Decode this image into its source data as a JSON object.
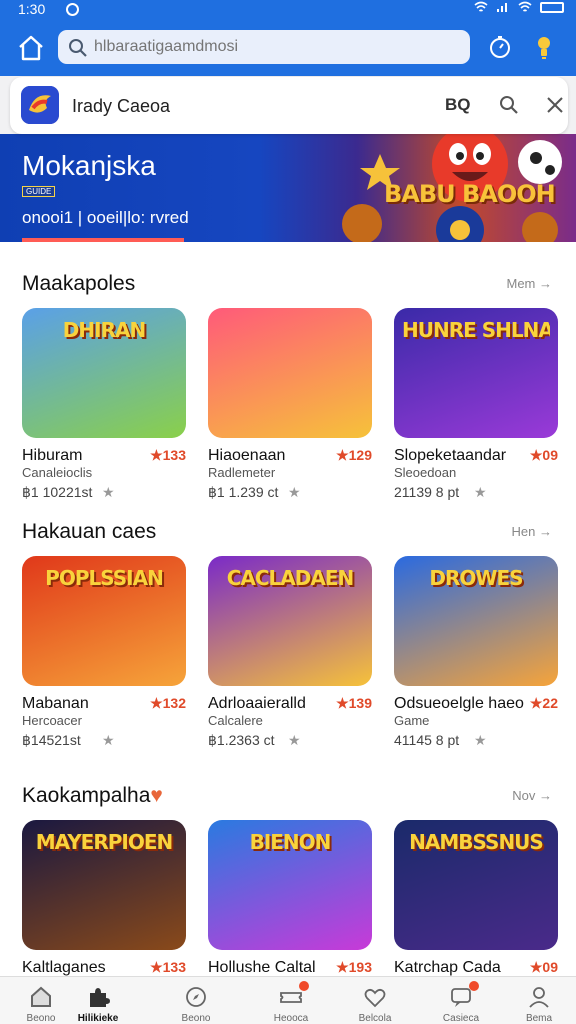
{
  "status": {
    "time": "1:30"
  },
  "search": {
    "placeholder": "hlbaraatigaamdmosi"
  },
  "card": {
    "app_name": "Irady Caeoa",
    "code_label": "BQ"
  },
  "hero": {
    "title": "Mokanjska",
    "tag": "GUIDE",
    "subtitle": "onooi1 | ooeil|lo: rvred",
    "art_text": "BABU BAOOH"
  },
  "sections": [
    {
      "title": "Maakapoles",
      "more": "Mem",
      "games": [
        {
          "name": "Hiburam",
          "sub": "Canaleioclis",
          "downloads": "฿1 10221st",
          "rating": "★133",
          "banner": "DHIRAN",
          "colors": [
            "#5aa0e8",
            "#8ad04a"
          ]
        },
        {
          "name": "Hiaoenaan",
          "sub": "Radlemeter",
          "downloads": "฿1 1.239 ct",
          "rating": "★129",
          "banner": "",
          "colors": [
            "#ff5a7a",
            "#f6c23a"
          ]
        },
        {
          "name": "Slopeketaandar",
          "sub": "Sleoedoan",
          "downloads": "21139 8 pt",
          "rating": "★09",
          "banner": "HUNRE SHLNAN",
          "colors": [
            "#3a2aa8",
            "#9a3ad8"
          ]
        }
      ]
    },
    {
      "title": "Hakauan caes",
      "more": "Hen",
      "games": [
        {
          "name": "Mabanan",
          "sub": "Hercoacer",
          "downloads": "฿14521st",
          "rating": "★132",
          "banner": "POPLSSIAN",
          "colors": [
            "#e0381a",
            "#f6a43a"
          ]
        },
        {
          "name": "Adrloaaieralld",
          "sub": "Calcalere",
          "downloads": "฿1.2363 ct",
          "rating": "★139",
          "banner": "CACLADAEN",
          "colors": [
            "#7a2ac8",
            "#f6c23a"
          ]
        },
        {
          "name": "Odsueoelgle haeo",
          "sub": "Game",
          "downloads": "41145 8 pt",
          "rating": "★22",
          "banner": "DROWES",
          "colors": [
            "#2a6ae0",
            "#f6a43a"
          ]
        }
      ]
    },
    {
      "title": "Kaokampalha",
      "more": "Nov",
      "games": [
        {
          "name": "Kaltlaganes",
          "sub": "",
          "downloads": "",
          "rating": "★133",
          "banner": "MAYERPIOEN",
          "colors": [
            "#1a1840",
            "#8a4a1a"
          ]
        },
        {
          "name": "Hollushe Caltal",
          "sub": "",
          "downloads": "",
          "rating": "★193",
          "banner": "BIENON",
          "colors": [
            "#2a7ae0",
            "#c83ad8"
          ]
        },
        {
          "name": "Katrchap Cada",
          "sub": "",
          "downloads": "",
          "rating": "★09",
          "banner": "NAMBSSNUS",
          "colors": [
            "#1a2a6a",
            "#4a2a8a"
          ]
        }
      ]
    }
  ],
  "tabs": [
    {
      "label": "Beono",
      "icon": "home-icon"
    },
    {
      "label": "Hilikieke",
      "icon": "puzzle-icon"
    },
    {
      "label": "Beono",
      "icon": "compass-icon"
    },
    {
      "label": "Heooca",
      "icon": "ticket-icon"
    },
    {
      "label": "Belcola",
      "icon": "heart-icon"
    },
    {
      "label": "Casieca",
      "icon": "chat-icon"
    },
    {
      "label": "Bema",
      "icon": "person-icon"
    }
  ]
}
